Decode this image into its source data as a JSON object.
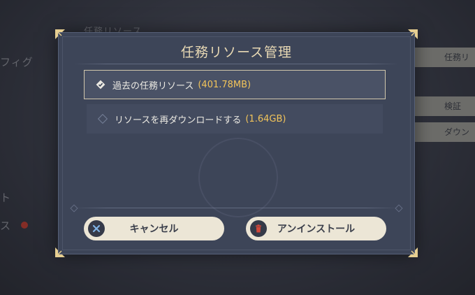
{
  "background": {
    "left_texts": [
      "フィグ",
      "ト",
      "ス"
    ],
    "top_text": "任務リソース",
    "right_buttons": [
      "任務リ",
      "検証",
      "ダウン"
    ]
  },
  "dialog": {
    "title": "任務リソース管理",
    "options": [
      {
        "label": "過去の任務リソース",
        "size": "(401.78MB)",
        "selected": true
      },
      {
        "label": "リソースを再ダウンロードする",
        "size": "(1.64GB)",
        "selected": false
      }
    ],
    "buttons": {
      "cancel": {
        "label": "キャンセル",
        "icon": "close-icon"
      },
      "uninstall": {
        "label": "アンインストール",
        "icon": "trash-icon"
      }
    }
  },
  "colors": {
    "dialog_bg": "#3d4558",
    "title": "#e8d9b4",
    "size_accent": "#f2c45a",
    "button_bg": "#ece6d6",
    "uninstall_icon": "#c0392b"
  }
}
